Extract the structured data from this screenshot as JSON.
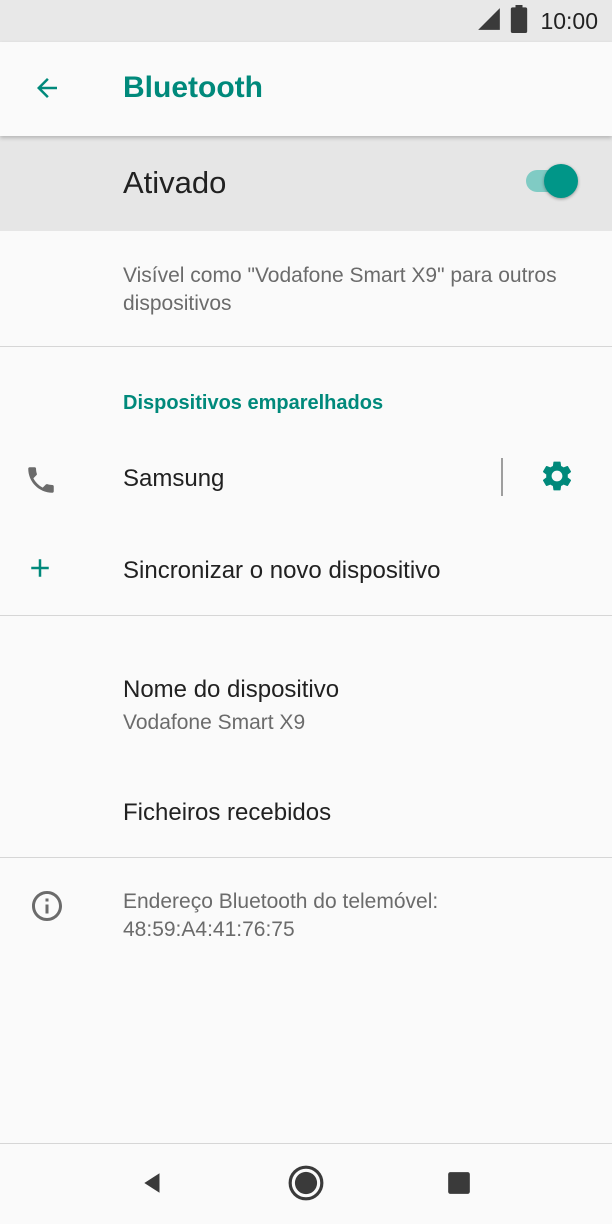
{
  "status_bar": {
    "time": "10:00",
    "icons": [
      "signal-icon",
      "battery-icon"
    ]
  },
  "app_bar": {
    "title": "Bluetooth",
    "back_icon": "arrow-back-icon"
  },
  "master_switch": {
    "label": "Ativado",
    "state": "on"
  },
  "visibility_text": "Visível como \"Vodafone Smart X9\" para outros dispositivos",
  "paired_section": {
    "header": "Dispositivos emparelhados",
    "devices": [
      {
        "name": "Samsung",
        "icon": "phone-icon",
        "settings_icon": "gear-icon"
      }
    ]
  },
  "pair_new": {
    "label": "Sincronizar o novo dispositivo",
    "icon": "plus-icon"
  },
  "device_name": {
    "label": "Nome do dispositivo",
    "value": "Vodafone Smart X9"
  },
  "received_files": {
    "label": "Ficheiros recebidos"
  },
  "address_info": {
    "icon": "info-icon",
    "text_line1": "Endereço Bluetooth do telemóvel:",
    "text_line2": "48:59:A4:41:76:75"
  },
  "nav_bar": {
    "buttons": [
      "back-triangle-icon",
      "home-circle-icon",
      "recents-square-icon"
    ]
  },
  "colors": {
    "accent": "#00897b",
    "toggle_thumb": "#009688",
    "toggle_track": "#80cbc4"
  }
}
